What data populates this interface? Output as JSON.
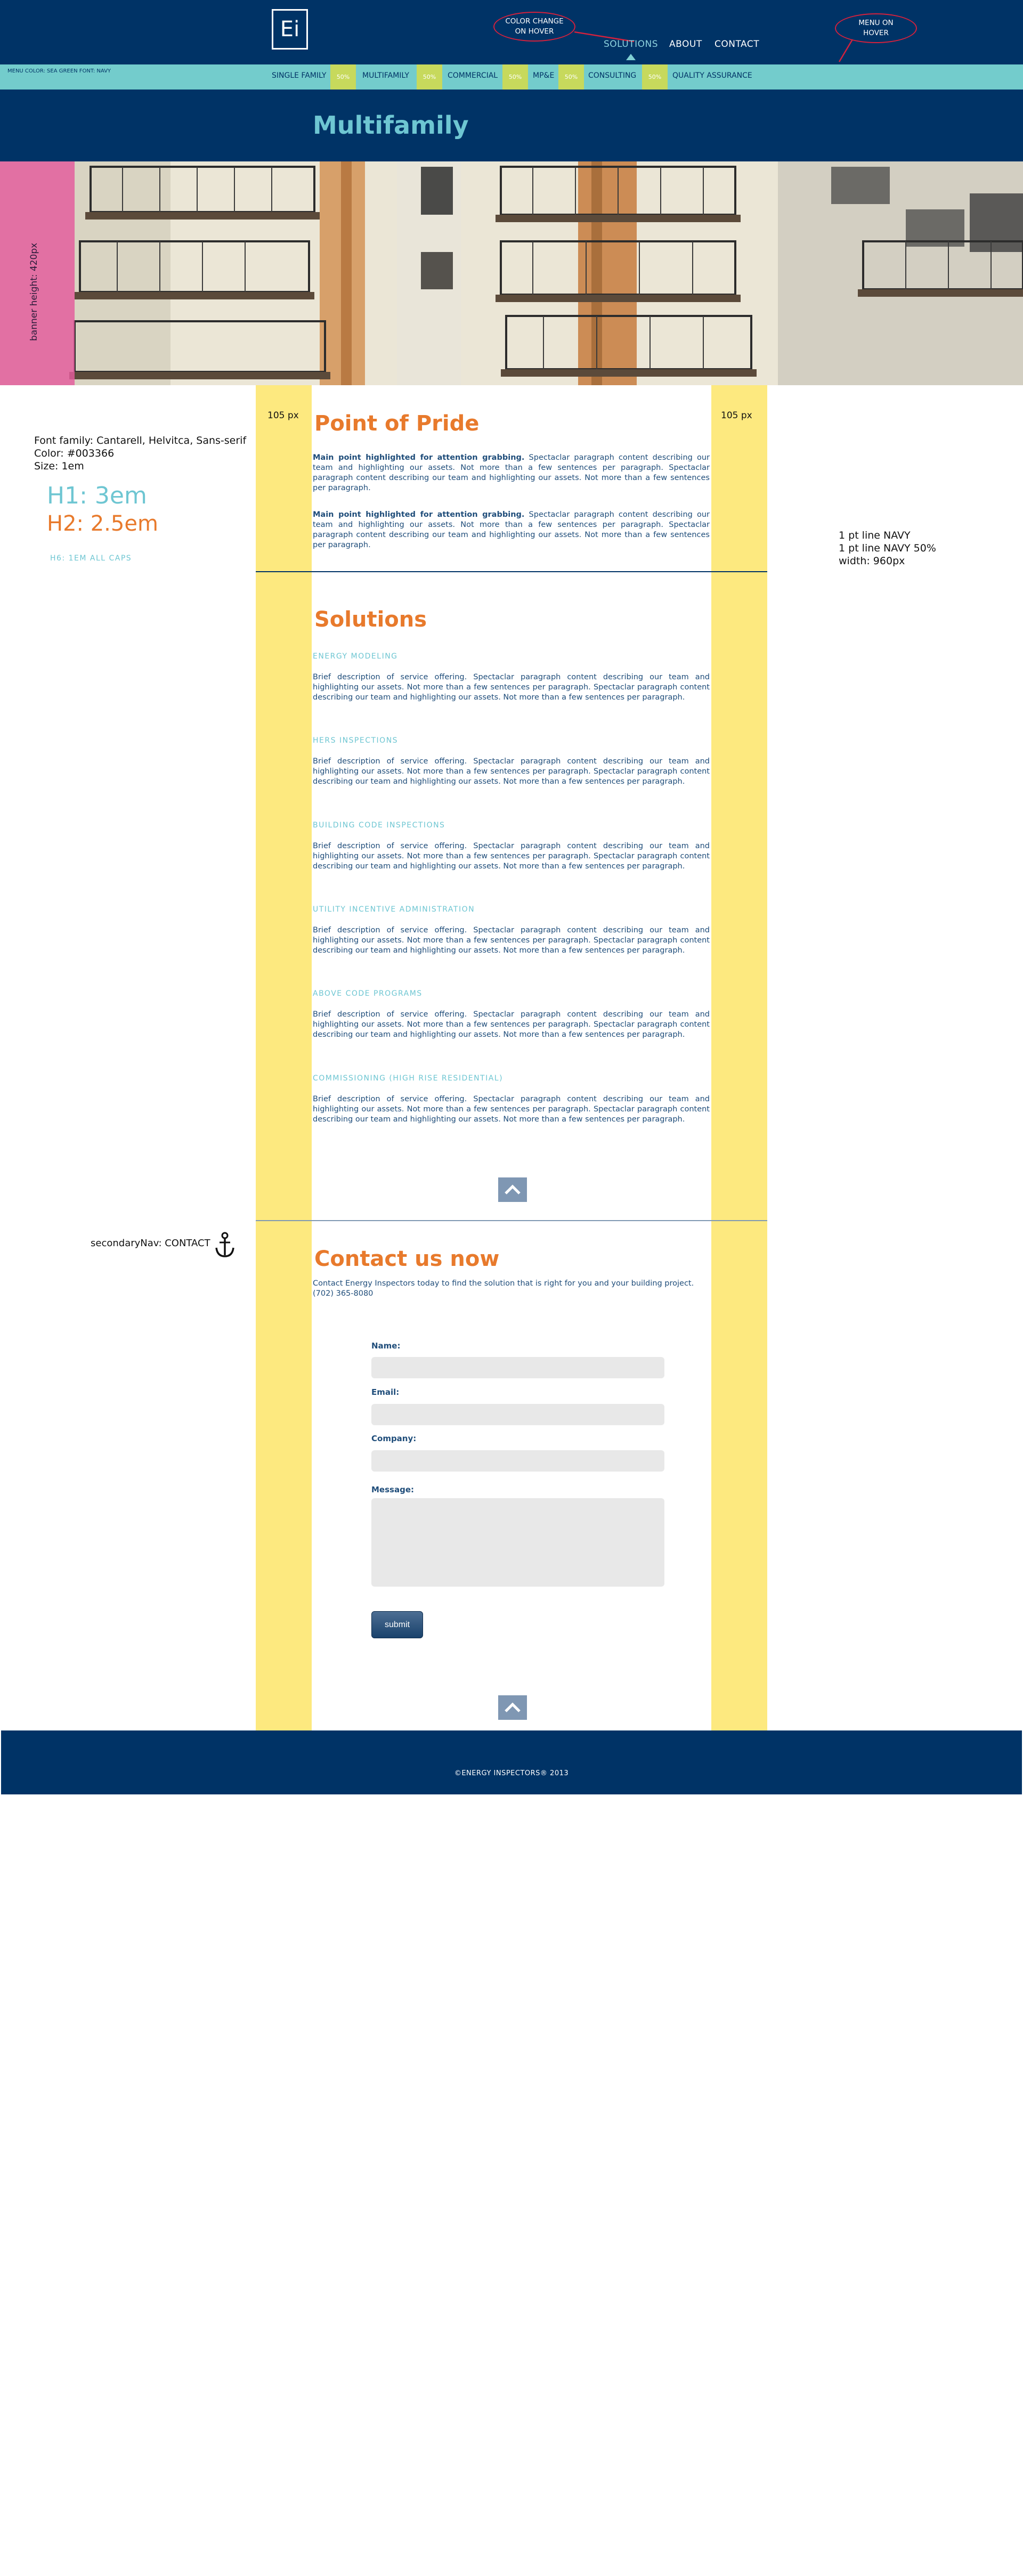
{
  "header": {
    "logo_text": "Ei",
    "nav": [
      {
        "label": "SOLUTIONS"
      },
      {
        "label": "ABOUT"
      },
      {
        "label": "CONTACT"
      }
    ],
    "annotation_color_change": "COLOR CHANGE ON HOVER",
    "annotation_menu_hover": "MENU ON HOVER"
  },
  "subnav": {
    "note": "MENU COLOR: SEA GREEN FONT: NAVY",
    "items": [
      "SINGLE FAMILY",
      "MULTIFAMILY",
      "COMMERCIAL",
      "MP&E",
      "CONSULTING",
      "QUALITY ASSURANCE"
    ],
    "hover_chip": "50%"
  },
  "page": {
    "title": "Multifamily",
    "banner_note": "banner height: 420px"
  },
  "annotations": {
    "font_family": "Font family: Cantarell, Helvitca, Sans-serif",
    "color": "Color: #003366",
    "size": "Size: 1em",
    "h1": "H1: 3em",
    "h2": "H2: 2.5em",
    "h6": "H6: 1EM ALL CAPS",
    "line_navy": "1 pt line NAVY",
    "line_navy50": "1 pt line NAVY 50%",
    "width": "width: 960px",
    "px_left": "105 px",
    "px_right": "105 px",
    "secondary_nav": "secondaryNav: CONTACT"
  },
  "pride": {
    "heading": "Point of Pride",
    "paragraphs": [
      {
        "lead": "Main point highlighted for attention grabbing.",
        "body": " Spectaclar paragraph content describing our team and highlighting our assets. Not more than a few sentences per paragraph. Spectaclar paragraph content describing our team and highlighting our assets. Not more than a few sentences per paragraph."
      },
      {
        "lead": "Main point highlighted for attention grabbing.",
        "body": " Spectaclar paragraph content describing our team and highlighting our assets. Not more than a few sentences per paragraph. Spectaclar paragraph content describing our team and highlighting our assets. Not more than a few sentences per paragraph."
      }
    ]
  },
  "solutions": {
    "heading": "Solutions",
    "items": [
      {
        "title": "ENERGY MODELING",
        "desc": "Brief description of service offering. Spectaclar paragraph content describing our team and highlighting our assets. Not more than a few sentences per paragraph. Spectaclar paragraph content describing our team and highlighting our assets. Not more than a few sentences per paragraph."
      },
      {
        "title": "HERS INSPECTIONS",
        "desc": "Brief description of service offering. Spectaclar paragraph content describing our team and highlighting our assets. Not more than a few sentences per paragraph. Spectaclar paragraph content describing our team and highlighting our assets. Not more than a few sentences per paragraph."
      },
      {
        "title": "BUILDING CODE INSPECTIONS",
        "desc": "Brief description of service offering. Spectaclar paragraph content describing our team and highlighting our assets. Not more than a few sentences per paragraph. Spectaclar paragraph content describing our team and highlighting our assets. Not more than a few sentences per paragraph."
      },
      {
        "title": "UTILITY INCENTIVE ADMINISTRATION",
        "desc": "Brief description of service offering. Spectaclar paragraph content describing our team and highlighting our assets. Not more than a few sentences per paragraph. Spectaclar paragraph content describing our team and highlighting our assets. Not more than a few sentences per paragraph."
      },
      {
        "title": "ABOVE CODE PROGRAMS",
        "desc": "Brief description of service offering. Spectaclar paragraph content describing our team and highlighting our assets. Not more than a few sentences per paragraph. Spectaclar paragraph content describing our team and highlighting our assets. Not more than a few sentences per paragraph."
      },
      {
        "title": "COMMISSIONING (HIGH RISE RESIDENTIAL)",
        "desc": "Brief description of service offering. Spectaclar paragraph content describing our team and highlighting our assets. Not more than a few sentences per paragraph. Spectaclar paragraph content describing our team and highlighting our assets. Not more than a few sentences per paragraph."
      }
    ]
  },
  "contact": {
    "heading": "Contact us now",
    "intro": "Contact Energy Inspectors today to find the solution that is right for you and your building project.",
    "phone": "(702) 365-8080",
    "labels": {
      "name": "Name:",
      "email": "Email:",
      "company": "Company:",
      "message": "Message:"
    },
    "submit": "submit"
  },
  "footer": {
    "text": "©ENERGY INSPECTORS® 2013"
  },
  "colors": {
    "navy": "#003366",
    "sea_green": "#73cccc",
    "orange": "#e87a2c",
    "guide_yellow": "#fde97f",
    "hover_chip": "#c7d95c"
  }
}
